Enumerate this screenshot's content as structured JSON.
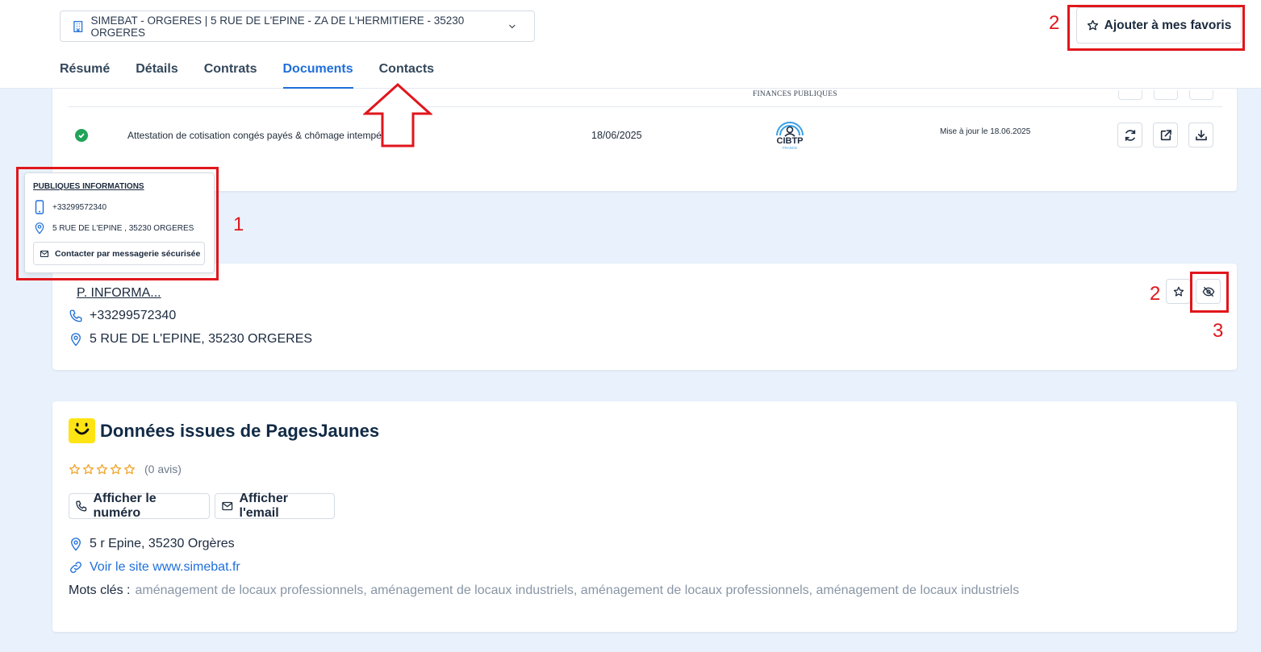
{
  "header": {
    "company_select": "SIMEBAT - ORGERES | 5 RUE DE L'EPINE - ZA DE L'HERMITIERE - 35230 ORGERES",
    "favorite_button": "Ajouter à mes favoris",
    "tabs": [
      {
        "label": "Résumé",
        "active": false
      },
      {
        "label": "Détails",
        "active": false
      },
      {
        "label": "Contrats",
        "active": false
      },
      {
        "label": "Documents",
        "active": true
      },
      {
        "label": "Contacts",
        "active": false
      }
    ]
  },
  "documents": {
    "partial_logo_text": "FINANCES PUBLIQUES",
    "row": {
      "status": "ok",
      "title": "Attestation de cotisation congés payés & chômage intempéries",
      "date": "18/06/2025",
      "issuer_logo": "CIBTP",
      "issuer_logo_sub": "FRANCE",
      "update_text": "Mise à jour le 18.06.2025",
      "actions": [
        "refresh-icon",
        "external-link-icon",
        "download-icon"
      ]
    }
  },
  "popover": {
    "title": "PUBLIQUES INFORMATIONS",
    "phone": "+33299572340",
    "address": "5 RUE DE L'EPINE , 35230 ORGERES",
    "message_button": "Contacter par messagerie sécurisée"
  },
  "contact_card": {
    "name": "P. INFORMA...",
    "phone": "+33299572340",
    "address": "5 RUE DE L'EPINE, 35230 ORGERES"
  },
  "pagesjaunes": {
    "title": "Données issues de PagesJaunes",
    "rating": 0,
    "reviews": "(0 avis)",
    "show_number_button": "Afficher le numéro",
    "show_email_button": "Afficher l'email",
    "address": "5 r Epine, 35230 Orgères",
    "website": "Voir le site www.simebat.fr",
    "keywords_label": "Mots clés :",
    "keywords": "aménagement de locaux professionnels, aménagement de locaux industriels, aménagement de locaux professionnels, aménagement de locaux industriels"
  },
  "annotations": {
    "n1": "1",
    "n2_header": "2",
    "n2_card": "2",
    "n3": "3"
  },
  "colors": {
    "accent": "#1f6fd9",
    "annotation": "#e0161c",
    "success": "#22a35a",
    "pagesjaunes_yellow": "#ffe414",
    "star": "#f0a020"
  }
}
